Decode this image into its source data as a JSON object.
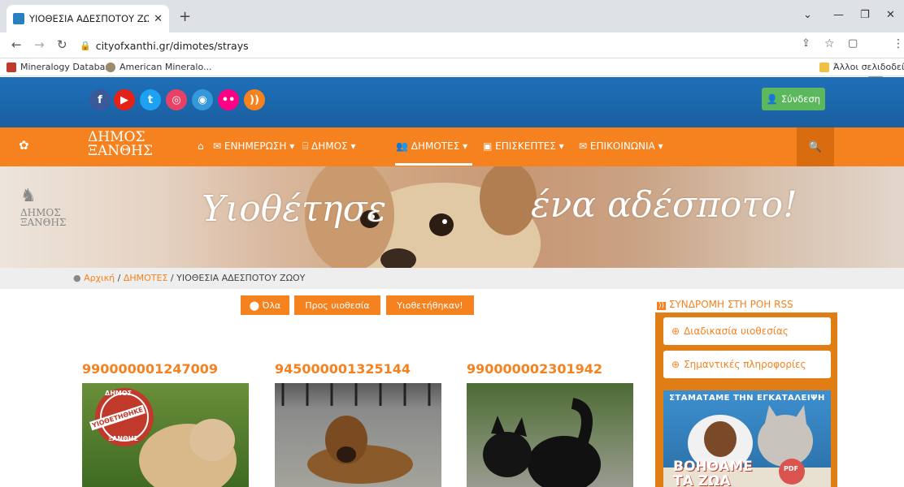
{
  "browser": {
    "tab_title": "ΥΙΟΘΕΣΙΑ ΑΔΕΣΠΟΤΟΥ ΖΩΟΥ - Δ",
    "url": "cityofxanthi.gr/dimotes/strays",
    "bookmarks": [
      "Mineralogy Database",
      "American Mineralo..."
    ],
    "other_bookmarks": "Άλλοι σελιδοδείκτε"
  },
  "header": {
    "social_icons": [
      "facebook-icon",
      "youtube-icon",
      "twitter-icon",
      "instagram-icon",
      "chrome-icon",
      "flickr-icon",
      "rss-icon"
    ],
    "login_label": "Σύνδεση",
    "logo_line1": "ΔΗΜΟΣ",
    "logo_line2": "ΞΑΝΘΗΣ",
    "menu": [
      "ΕΝΗΜΕΡΩΣΗ",
      "ΔΗΜΟΣ",
      "ΔΗΜΟΤΕΣ",
      "ΕΠΙΣΚΕΠΤΕΣ",
      "ΕΠΙΚΟΙΝΩΝΙΑ"
    ]
  },
  "banner": {
    "left_logo_line1": "ΔΗΜΟΣ",
    "left_logo_line2": "ΞΑΝΘΗΣ",
    "text_left": "Υιοθέτησε",
    "text_right": "ένα αδέσποτο!"
  },
  "breadcrumb": {
    "home": "Αρχική",
    "section": "ΔΗΜΟΤΕΣ",
    "current": "ΥΙΟΘΕΣΙΑ ΑΔΕΣΠΟΤΟΥ ΖΩΟΥ"
  },
  "filters": [
    "Όλα",
    "Προς υιοθεσία",
    "Υιοθετήθηκαν!"
  ],
  "animals": [
    {
      "id": "990000001247009",
      "badge_top": "ΔΗΜΟΣ",
      "badge_mid": "ΥΙΟΘΕΤΗΘΗΚΕ",
      "badge_bottom": "ΞΑΝΘΗΣ"
    },
    {
      "id": "945000001325144"
    },
    {
      "id": "990000002301942"
    }
  ],
  "sidebar": {
    "rss_label": "ΣΥΝΔΡΟΜΗ ΣΤΗ ΡΟΗ RSS",
    "items": [
      "Διαδικασία υιοθεσίας",
      "Σημαντικές πληροφορίες"
    ],
    "poster_top": "ΣΤΑΜΑΤΑΜΕ ΤΗΝ ΕΓΚΑΤΑΛΕΙΨΗ",
    "poster_bottom_1": "ΒΟΗΘΑΜΕ",
    "poster_bottom_2": "ΤΑ ΖΩΑ",
    "poster_badge": "PDF"
  },
  "colors": {
    "orange": "#f5821f",
    "blue": "#1e6fb8",
    "green": "#5cb85c"
  }
}
